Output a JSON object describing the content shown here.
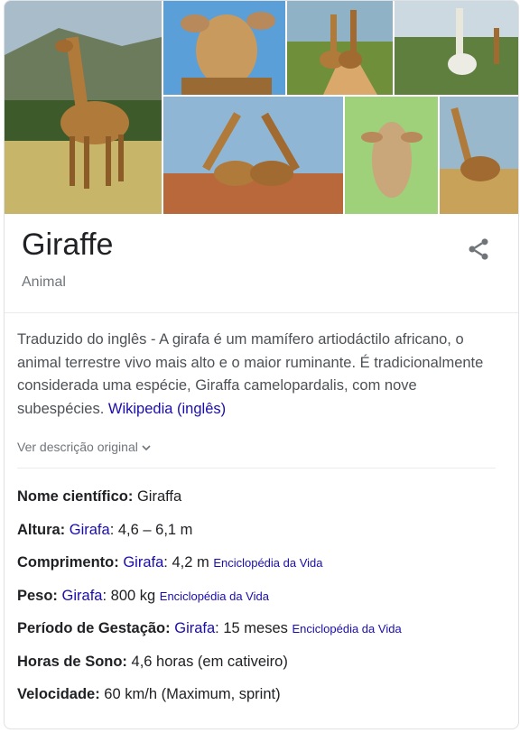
{
  "entity": {
    "title": "Giraffe",
    "subtitle": "Animal"
  },
  "gallery": {
    "icons": [
      "giraffe-photo",
      "share-icon"
    ],
    "photos": [
      "giraffe-savanna-photo",
      "giraffe-closeup-photo",
      "giraffes-road-photo",
      "white-giraffe-photo",
      "giraffes-necks-photo",
      "giraffe-face-photo",
      "giraffe-field-photo"
    ]
  },
  "description": {
    "text": "Traduzido do inglês - A girafa é um mamífero artiodáctilo africano, o animal terrestre vivo mais alto e o maior ruminante. É tradicionalmente considerada uma espécie, Giraffa camelopardalis, com nove subespécies.",
    "source_link": "Wikipedia (inglês)",
    "original_toggle": "Ver descrição original"
  },
  "facts": [
    {
      "label": "Nome científico:",
      "text": "Giraffa"
    },
    {
      "label": "Altura:",
      "link": "Girafa",
      "text": ": 4,6 – 6,1 m"
    },
    {
      "label": "Comprimento:",
      "link": "Girafa",
      "text": ": 4,2 m",
      "source": "Enciclopédia da Vida"
    },
    {
      "label": "Peso:",
      "link": "Girafa",
      "text": ": 800 kg",
      "source": "Enciclopédia da Vida"
    },
    {
      "label": "Período de Gestação:",
      "link": "Girafa",
      "text": ": 15 meses",
      "source": "Enciclopédia da Vida"
    },
    {
      "label": "Horas de Sono:",
      "text": "4,6 horas (em cativeiro)"
    },
    {
      "label": "Velocidade:",
      "text": "60 km/h (Maximum, sprint)"
    }
  ],
  "colors": {
    "link": "#1a0dab",
    "title": "#202124",
    "muted": "#70757a"
  }
}
